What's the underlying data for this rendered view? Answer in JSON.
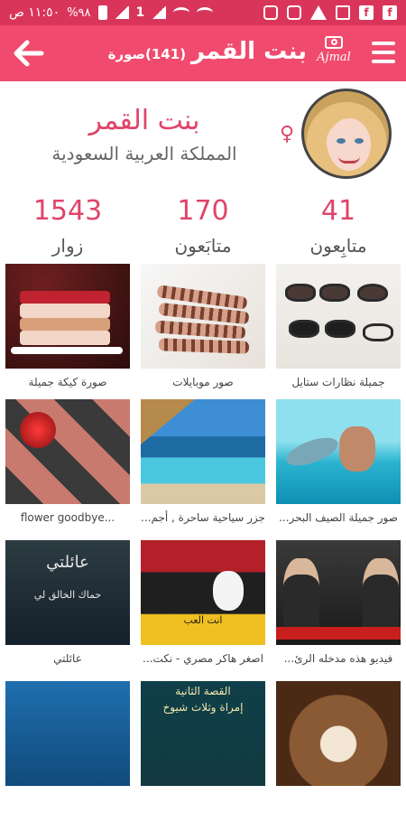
{
  "status_bar": {
    "time": "١١:٥٠ ص",
    "battery": "%٩٨",
    "sim": "1",
    "left_icons": [
      "alarm-icon",
      "battery-icon",
      "signal-icon",
      "sim-icon",
      "signal-icon",
      "wifi-icon",
      "wifi-icon"
    ],
    "right_icons": [
      "instagram-icon",
      "instagram-icon",
      "warning-icon",
      "image-icon",
      "facebook-icon",
      "facebook-icon"
    ]
  },
  "app_bar": {
    "title": "بنت القمر",
    "photo_count": "(141)صورة",
    "logo_text": "Ajmal",
    "back_icon": "arrow-left-icon",
    "menu_icon": "hamburger-menu-icon"
  },
  "profile": {
    "name": "بنت القمر",
    "country": "المملكة العربية السعودية",
    "gender_symbol": "♀",
    "avatar_icon": "user-avatar"
  },
  "stats": [
    {
      "value": "1543",
      "label": "زوار"
    },
    {
      "value": "170",
      "label": "متابَعون"
    },
    {
      "value": "41",
      "label": "متابِعون"
    }
  ],
  "photos": [
    {
      "caption": "صورة كيكة جميلة"
    },
    {
      "caption": "صور موبايلات"
    },
    {
      "caption": "جميلة نظارات ستايل"
    },
    {
      "caption": "flower    goodbye..."
    },
    {
      "caption": "جزر سياحية ساحرة , أجم..."
    },
    {
      "caption": "صور  جميلة الصيف البحر..."
    },
    {
      "caption": "عائلتي"
    },
    {
      "caption": "اصغر هاكر مصري - نكت..."
    },
    {
      "caption": "فيديو هذه مدخله الرئ..."
    },
    {
      "caption": ""
    },
    {
      "caption": ""
    },
    {
      "caption": ""
    }
  ],
  "photo_texts": {
    "family": "عائلتي",
    "family_sub": "حماك الخالق لي",
    "hacker": "انت العب",
    "story_title": "القصة الثانية",
    "story_sub": "إمراة وثلاث شيوخ"
  },
  "colors": {
    "status_bar": "#d9355a",
    "app_bar": "#f04b6e",
    "accent": "#e0446a",
    "text_secondary": "#666666"
  }
}
